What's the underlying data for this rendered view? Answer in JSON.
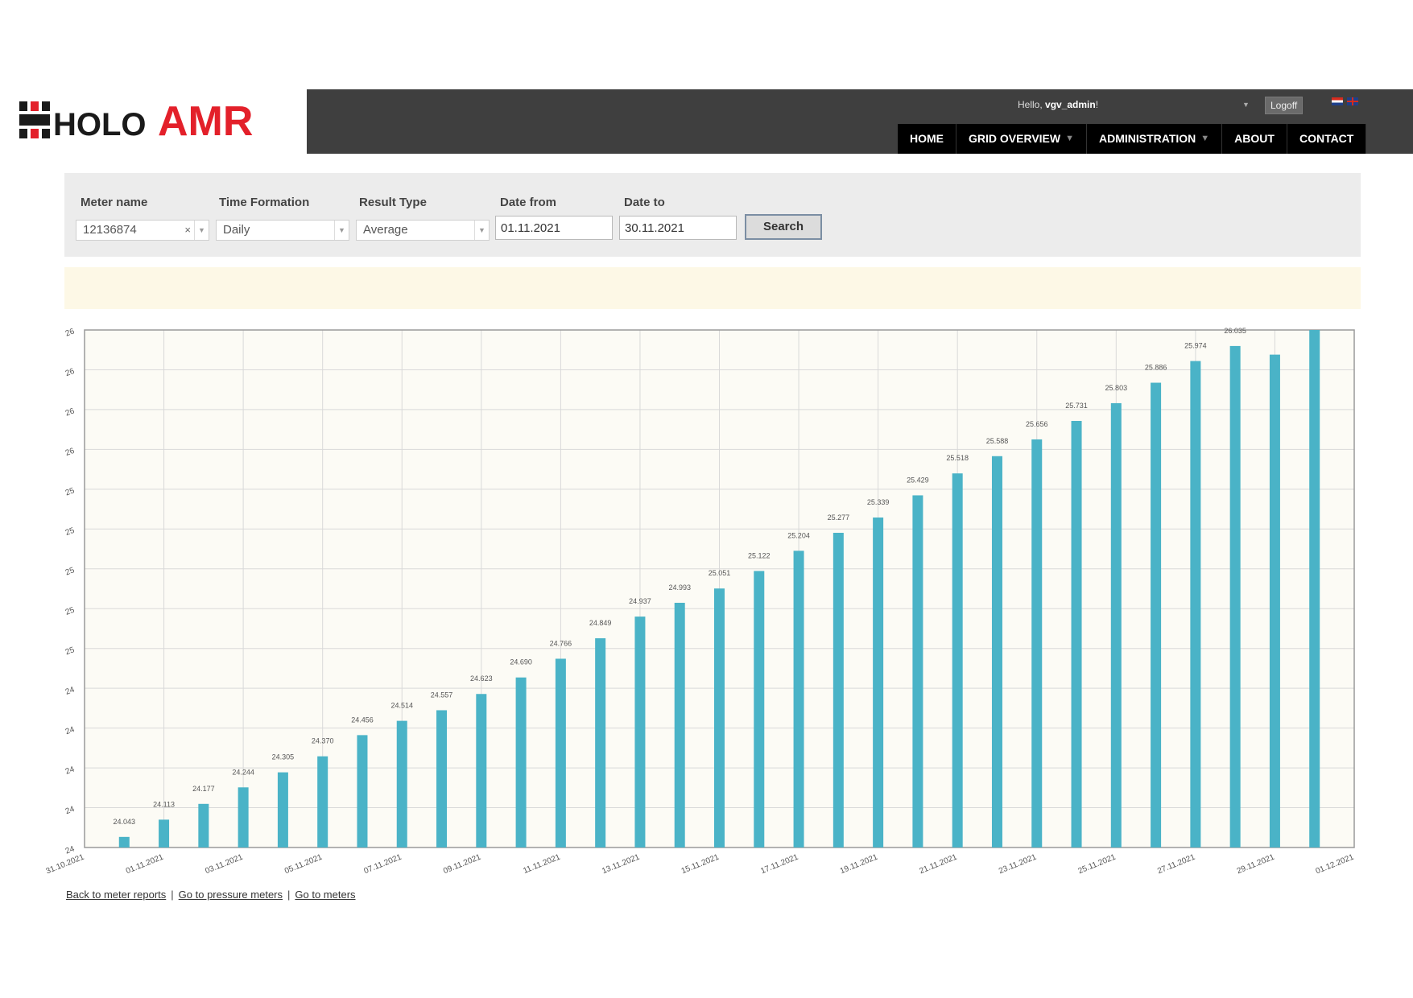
{
  "brand": {
    "logo_text_dark": "HOLO",
    "logo_text_red": "AMR",
    "logo_dark_color": "#1a1a1a",
    "logo_red_color": "#e3202a"
  },
  "header": {
    "greeting_prefix": "Hello, ",
    "username": "vgv_admin",
    "greeting_suffix": "!",
    "logoff_label": "Logoff",
    "nav": [
      {
        "label": "HOME",
        "has_dropdown": false
      },
      {
        "label": "GRID OVERVIEW",
        "has_dropdown": true
      },
      {
        "label": "ADMINISTRATION",
        "has_dropdown": true
      },
      {
        "label": "ABOUT",
        "has_dropdown": false
      },
      {
        "label": "CONTACT",
        "has_dropdown": false
      }
    ]
  },
  "filters": {
    "meter_name_label": "Meter name",
    "meter_name_value": "12136874",
    "time_formation_label": "Time Formation",
    "time_formation_value": "Daily",
    "result_type_label": "Result Type",
    "result_type_value": "Average",
    "date_from_label": "Date from",
    "date_from_value": "01.11.2021",
    "date_to_label": "Date to",
    "date_to_value": "30.11.2021",
    "search_label": "Search"
  },
  "chart_data": {
    "type": "bar",
    "bar_color": "#4ab3c7",
    "plot_background": "#fcfbf5",
    "grid": true,
    "y_tick_labels": [
      "24",
      "24",
      "24",
      "24",
      "24",
      "25",
      "25",
      "25",
      "25",
      "25",
      "26",
      "26",
      "26",
      "26"
    ],
    "ylim": [
      24.0,
      26.1
    ],
    "x_tick_labels": [
      "31.10.2021",
      "01.11.2021",
      "03.11.2021",
      "05.11.2021",
      "07.11.2021",
      "09.11.2021",
      "11.11.2021",
      "13.11.2021",
      "15.11.2021",
      "17.11.2021",
      "19.11.2021",
      "21.11.2021",
      "23.11.2021",
      "25.11.2021",
      "27.11.2021",
      "29.11.2021",
      "01.12.2021"
    ],
    "x_range_days": [
      0,
      32
    ],
    "bar_days": [
      1,
      2,
      3,
      4,
      5,
      6,
      7,
      8,
      9,
      10,
      11,
      12,
      13,
      14,
      15,
      16,
      17,
      18,
      19,
      20,
      21,
      22,
      23,
      24,
      25,
      26,
      27,
      28,
      29,
      30,
      31
    ],
    "values": [
      24.043,
      24.113,
      24.177,
      24.244,
      24.305,
      24.37,
      24.456,
      24.514,
      24.557,
      24.623,
      24.69,
      24.766,
      24.849,
      24.937,
      24.993,
      25.051,
      25.122,
      25.204,
      25.277,
      25.339,
      25.429,
      25.518,
      25.588,
      25.656,
      25.731,
      25.803,
      25.886,
      25.974,
      26.035,
      26.0,
      26.1
    ],
    "data_labels": [
      "24.043",
      "24.113",
      "24.177",
      "24.244",
      "24.305",
      "24.370",
      "24.456",
      "24.514",
      "24.557",
      "24.623",
      "24.690",
      "24.766",
      "24.849",
      "24.937",
      "24.993",
      "25.051",
      "25.122",
      "25.204",
      "25.277",
      "25.339",
      "25.429",
      "25.518",
      "25.588",
      "25.656",
      "25.731",
      "25.803",
      "25.886",
      "25.974",
      "26.035",
      "",
      ""
    ]
  },
  "footer": {
    "links": [
      "Back to meter reports",
      "Go to pressure meters",
      "Go to meters"
    ],
    "separator": "|"
  }
}
